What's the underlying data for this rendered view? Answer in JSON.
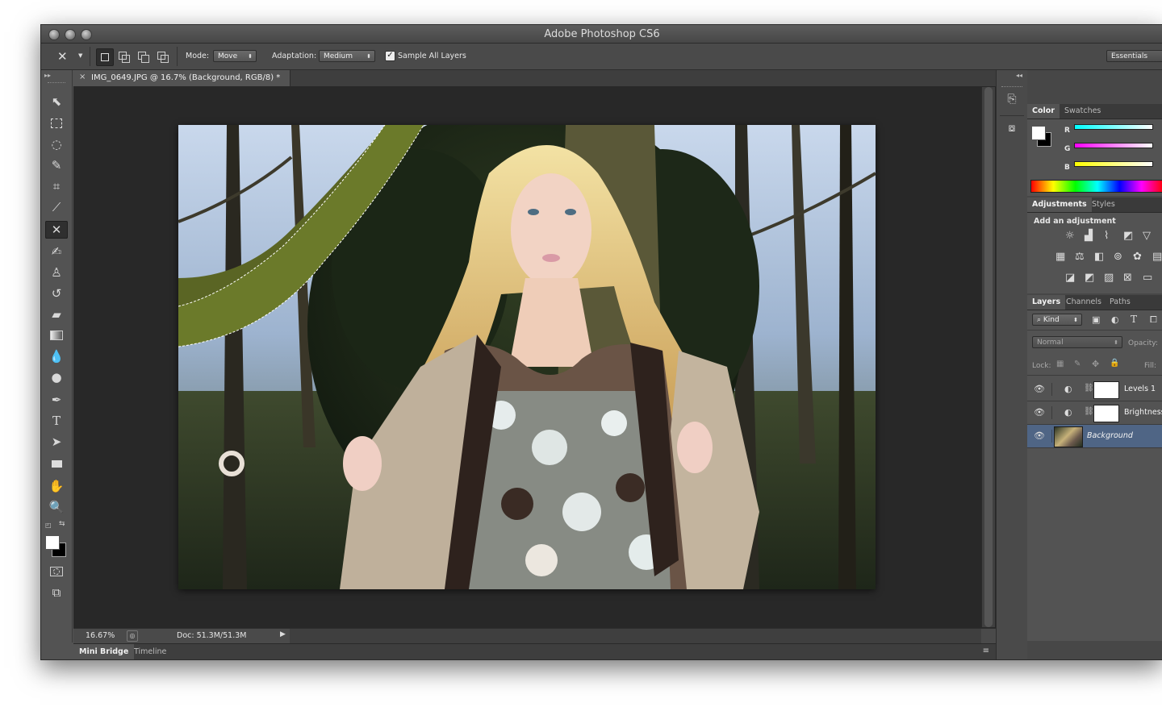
{
  "app": {
    "title": "Adobe Photoshop CS6"
  },
  "options_bar": {
    "mode_label": "Mode:",
    "mode_value": "Move",
    "adaptation_label": "Adaptation:",
    "adaptation_value": "Medium",
    "sample_all_label": "Sample All Layers",
    "sample_all_checked": true,
    "workspace": "Essentials"
  },
  "document": {
    "tab_title": "IMG_0649.JPG @ 16.7% (Background, RGB/8) *"
  },
  "status": {
    "zoom": "16.67%",
    "doc_size": "Doc: 51.3M/51.3M"
  },
  "bottom_tabs": [
    "Mini Bridge",
    "Timeline"
  ],
  "color_panel": {
    "tabs": [
      "Color",
      "Swatches"
    ],
    "channels": [
      "R",
      "G",
      "B"
    ]
  },
  "adjustments_panel": {
    "tabs": [
      "Adjustments",
      "Styles"
    ],
    "heading": "Add an adjustment"
  },
  "layers_panel": {
    "tabs": [
      "Layers",
      "Channels",
      "Paths"
    ],
    "filter_kind": "Kind",
    "blend_mode": "Normal",
    "opacity_label": "Opacity:",
    "lock_label": "Lock:",
    "fill_label": "Fill:",
    "layers": [
      {
        "name": "Levels 1",
        "selected": false
      },
      {
        "name": "Brightness",
        "selected": false
      },
      {
        "name": "Background",
        "selected": true
      }
    ]
  },
  "colors": {
    "accent_selected": "#4f6585",
    "canvas_bg": "#282828",
    "panel_bg": "#535353"
  }
}
